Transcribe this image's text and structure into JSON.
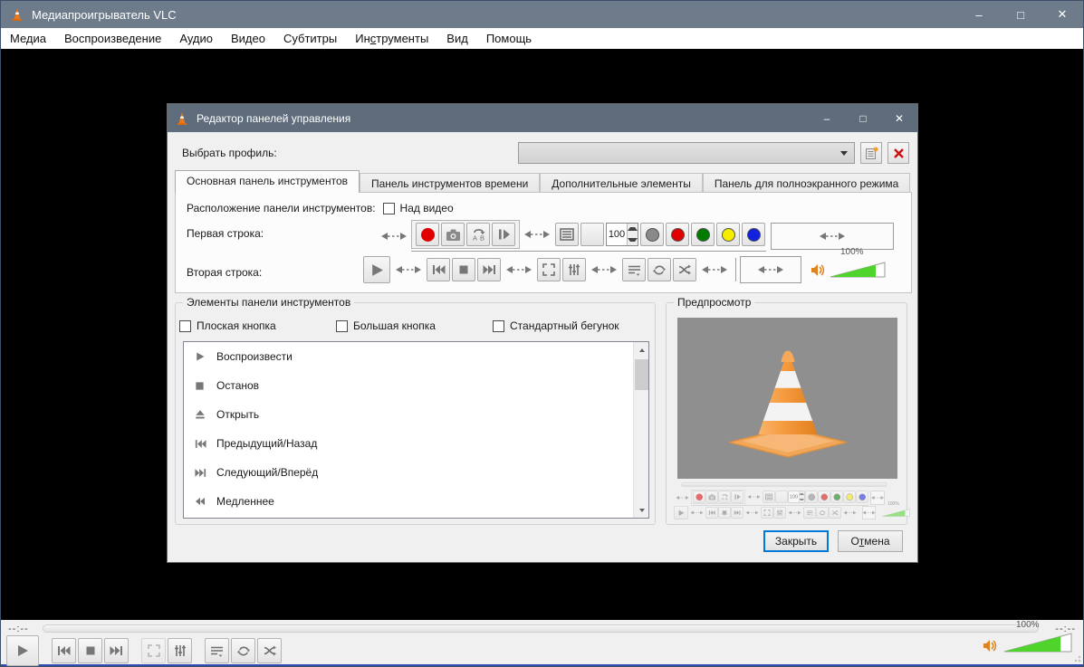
{
  "colors": {
    "accent": "#0078d7",
    "main-titlebar": "#6d7b8b",
    "dialog-titlebar": "#5e6c7c",
    "record-red": "#e00000",
    "teletext-gray": "#8a8a8a",
    "teletext-red": "#e00000",
    "teletext-green": "#007d00",
    "teletext-yellow": "#f5ec00",
    "teletext-blue": "#1420e0",
    "volume-green": "#4fd42c",
    "speaker-orange": "#e0821e"
  },
  "icons": {
    "minimize": "–",
    "maximize": "□",
    "close": "✕",
    "vlc-cone": "traffic-cone",
    "scroll_up": "▲",
    "scroll_down": "▼"
  },
  "main_window": {
    "title": "Медиапроигрыватель VLC",
    "menubar": {
      "items": [
        {
          "pre": "Медиа",
          "u": "",
          "post": ""
        },
        {
          "pre": "Воспроизведение",
          "u": "",
          "post": ""
        },
        {
          "pre": "Аудио",
          "u": "",
          "post": ""
        },
        {
          "pre": "Видео",
          "u": "",
          "post": ""
        },
        {
          "pre": "Субтитры",
          "u": "",
          "post": ""
        },
        {
          "pre": "Ин",
          "u": "с",
          "post": "трументы"
        },
        {
          "pre": "Вид",
          "u": "",
          "post": ""
        },
        {
          "pre": "Помощь",
          "u": "",
          "post": ""
        }
      ]
    },
    "bottom": {
      "time_left": "--:--",
      "time_right": "--:--",
      "volume_label": "100%"
    }
  },
  "dialog": {
    "title": "Редактор панелей управления",
    "profile_label": "Выбрать профиль:",
    "profile_value": "",
    "tabs": [
      {
        "label": "Основная панель инструментов",
        "active": true
      },
      {
        "label": "Панель инструментов времени",
        "active": false
      },
      {
        "label": "Дополнительные элементы",
        "active": false
      },
      {
        "label": "Панель для полноэкранного режима",
        "active": false
      }
    ],
    "position_label": "Расположение панели инструментов:",
    "over_video_label": "Над видео",
    "row1_label": "Первая строка:",
    "row2_label": "Вторая строка:",
    "spin_value": "100",
    "volume_label": "100%",
    "elements_group": {
      "title": "Элементы панели инструментов",
      "checkboxes": [
        {
          "label": "Плоская кнопка",
          "checked": false
        },
        {
          "label": "Большая кнопка",
          "checked": false
        },
        {
          "label": "Стандартный бегунок",
          "checked": false
        }
      ],
      "items": [
        {
          "icon": "play-icon",
          "label": "Воспроизвести"
        },
        {
          "icon": "stop-icon",
          "label": "Останов"
        },
        {
          "icon": "eject-icon",
          "label": "Открыть"
        },
        {
          "icon": "previous-icon",
          "label": "Предыдущий/Назад"
        },
        {
          "icon": "next-icon",
          "label": "Следующий/Вперёд"
        },
        {
          "icon": "slower-icon",
          "label": "Медленнее"
        }
      ]
    },
    "preview_group": {
      "title": "Предпросмотр"
    },
    "buttons": {
      "close": {
        "pre": "Закрыть",
        "u": "",
        "post": ""
      },
      "cancel": {
        "pre": "О",
        "u": "т",
        "post": "мена"
      }
    }
  }
}
